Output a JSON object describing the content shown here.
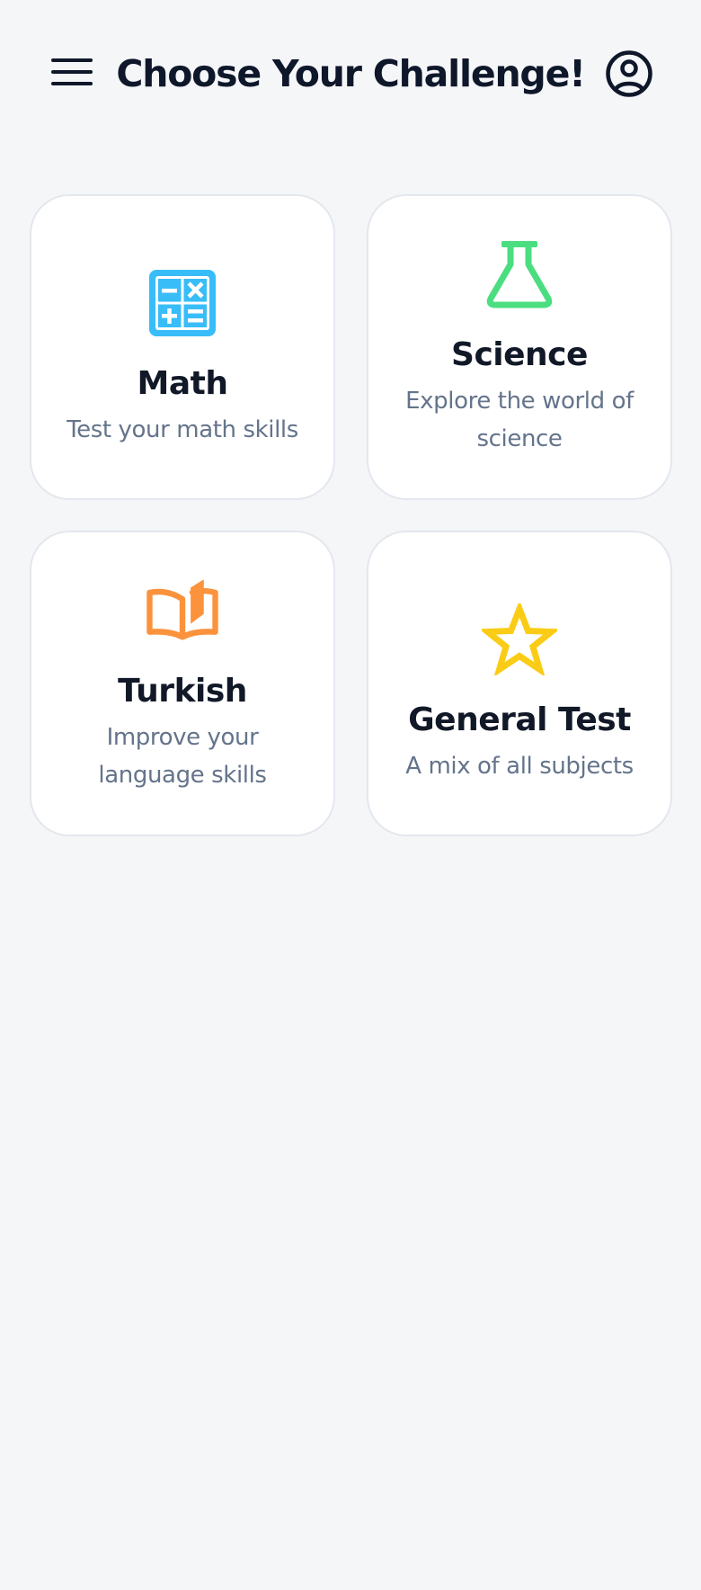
{
  "header": {
    "title": "Choose Your Challenge!",
    "menu_icon": "hamburger-menu-icon",
    "profile_icon": "user-circle-icon"
  },
  "categories": [
    {
      "title": "Math",
      "description": "Test your math skills",
      "icon": "calculator-icon",
      "color": "#38bdf8"
    },
    {
      "title": "Science",
      "description": "Explore the world of science",
      "icon": "flask-icon",
      "color": "#4ade80"
    },
    {
      "title": "Turkish",
      "description": "Improve your language skills",
      "icon": "open-book-icon",
      "color": "#fb923c"
    },
    {
      "title": "General Test",
      "description": "A mix of all subjects",
      "icon": "star-icon",
      "color": "#facc15"
    }
  ],
  "colors": {
    "background": "#f5f6f8",
    "card_border": "#e3e7ee",
    "title_text": "#0f172a",
    "description_text": "#64748b"
  }
}
